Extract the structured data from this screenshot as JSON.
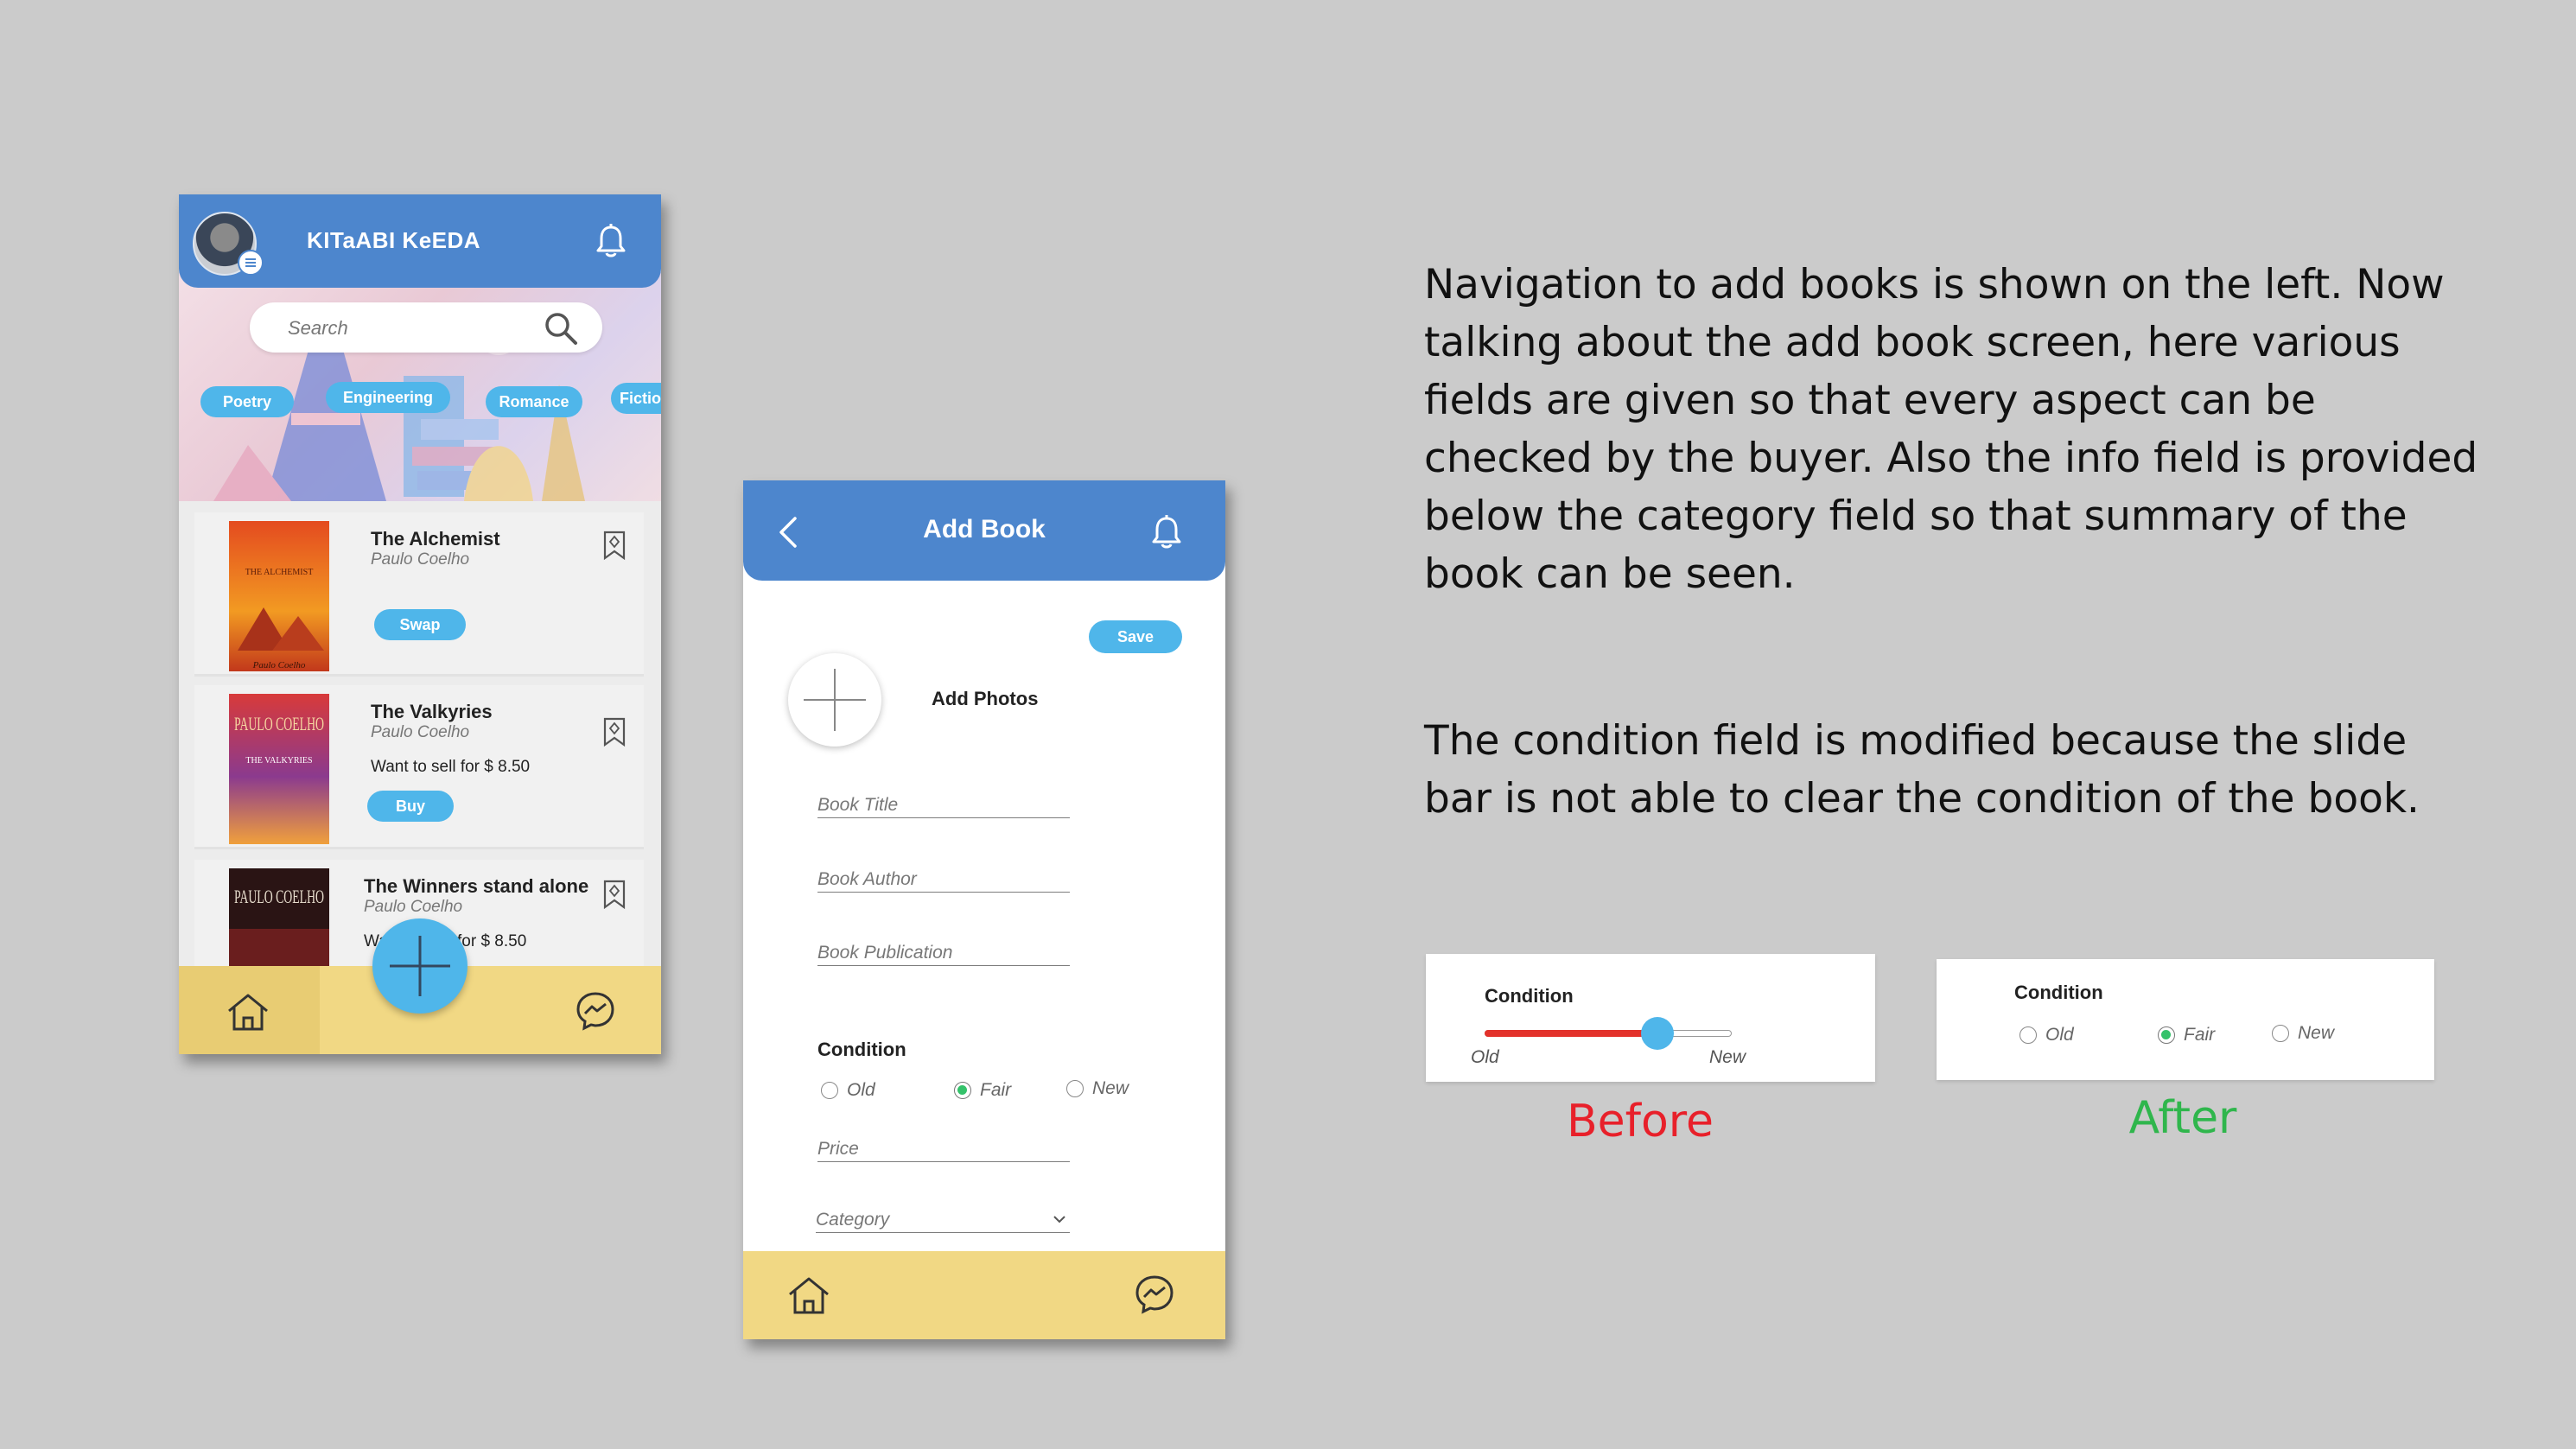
{
  "phone1": {
    "app_title": "KITaABI KeEDA",
    "search_placeholder": "Search",
    "chips": [
      "Poetry",
      "Engineering",
      "Romance",
      "Fictio"
    ],
    "books": [
      {
        "title": "The Alchemist",
        "author": "Paulo Coelho",
        "info": "",
        "action": "Swap"
      },
      {
        "title": "The Valkyries",
        "author": "Paulo Coelho",
        "info": "Want to sell for $ 8.50",
        "action": "Buy"
      },
      {
        "title": "The Winners stand alone",
        "author": "Paulo Coelho",
        "info_left": "Wa",
        "info_right": "for $ 8.50",
        "action": ""
      }
    ],
    "cover_texts": {
      "alchemist_top": "THE ALCHEMIST",
      "alchemist_bottom": "Paulo Coelho",
      "valkyries_author": "PAULO COELHO",
      "valkyries_title": "THE VALKYRIES",
      "winners_author": "PAULO COELHO"
    }
  },
  "phone2": {
    "title": "Add Book",
    "save_label": "Save",
    "add_photos_label": "Add Photos",
    "fields": {
      "book_title": "Book Title",
      "book_author": "Book Author",
      "book_publication": "Book Publication",
      "price": "Price",
      "category": "Category"
    },
    "condition": {
      "label": "Condition",
      "options": [
        "Old",
        "Fair",
        "New"
      ],
      "selected": "Fair"
    }
  },
  "description": {
    "paragraph1": "Navigation to add books is shown on the left. Now talking about the add book screen, here various fields are given so that every aspect can be checked by the buyer. Also the info field is provided below the category field so that summary of the book can be seen.",
    "paragraph2": "The condition field is modified because the slide bar is not able to clear the condition of the book."
  },
  "before": {
    "label": "Condition",
    "slider_min": "Old",
    "slider_max": "New",
    "slider_value_fraction": 0.7,
    "caption": "Before",
    "caption_color": "#e8202a"
  },
  "after": {
    "label": "Condition",
    "options": [
      "Old",
      "Fair",
      "New"
    ],
    "selected": "Fair",
    "caption": "After",
    "caption_color": "#2fb64c"
  },
  "colors": {
    "header_blue": "#4d86cd",
    "chip_blue": "#4fb6ea",
    "bottom_bar_yellow": "#f1d884",
    "radio_green": "#34c26a",
    "slider_red": "#e3322b"
  }
}
